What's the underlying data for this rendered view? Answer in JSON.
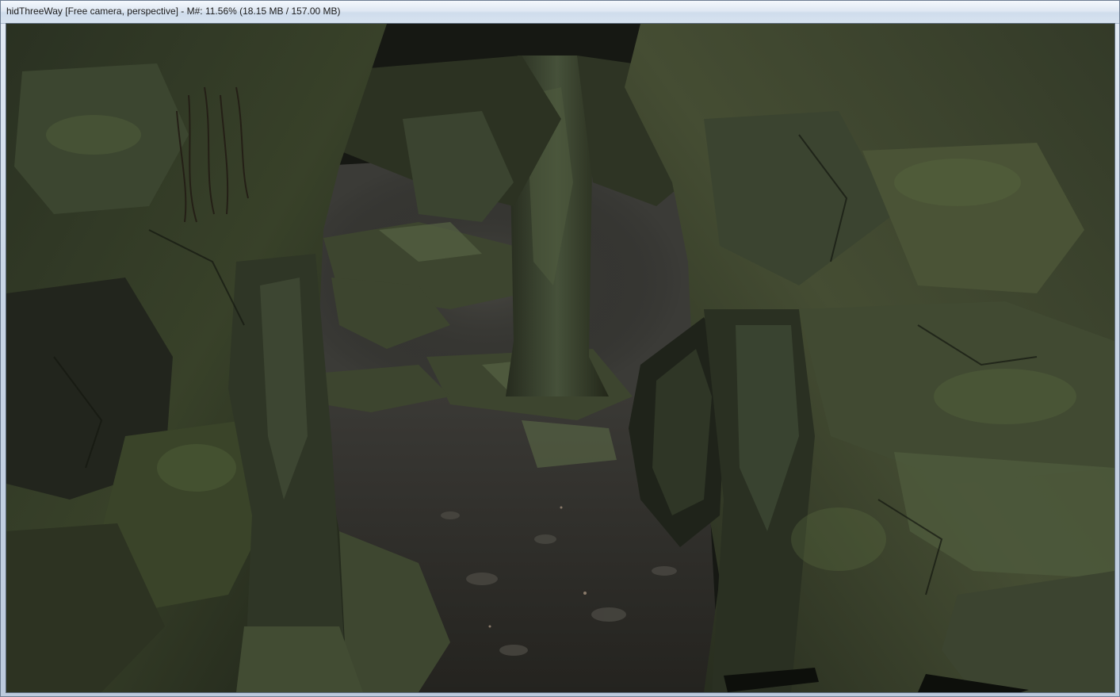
{
  "window": {
    "title": "hidThreeWay [Free camera, perspective] - M#: 11.56% (18.15 MB / 157.00 MB)"
  },
  "viewport": {
    "scene": "3d-cave-render",
    "colors": {
      "rock_dark": "#1c2018",
      "rock_mid": "#3a4230",
      "moss": "#4d5a36",
      "ground": "#2f2e2c",
      "background_rock": "#3b3a36"
    }
  }
}
